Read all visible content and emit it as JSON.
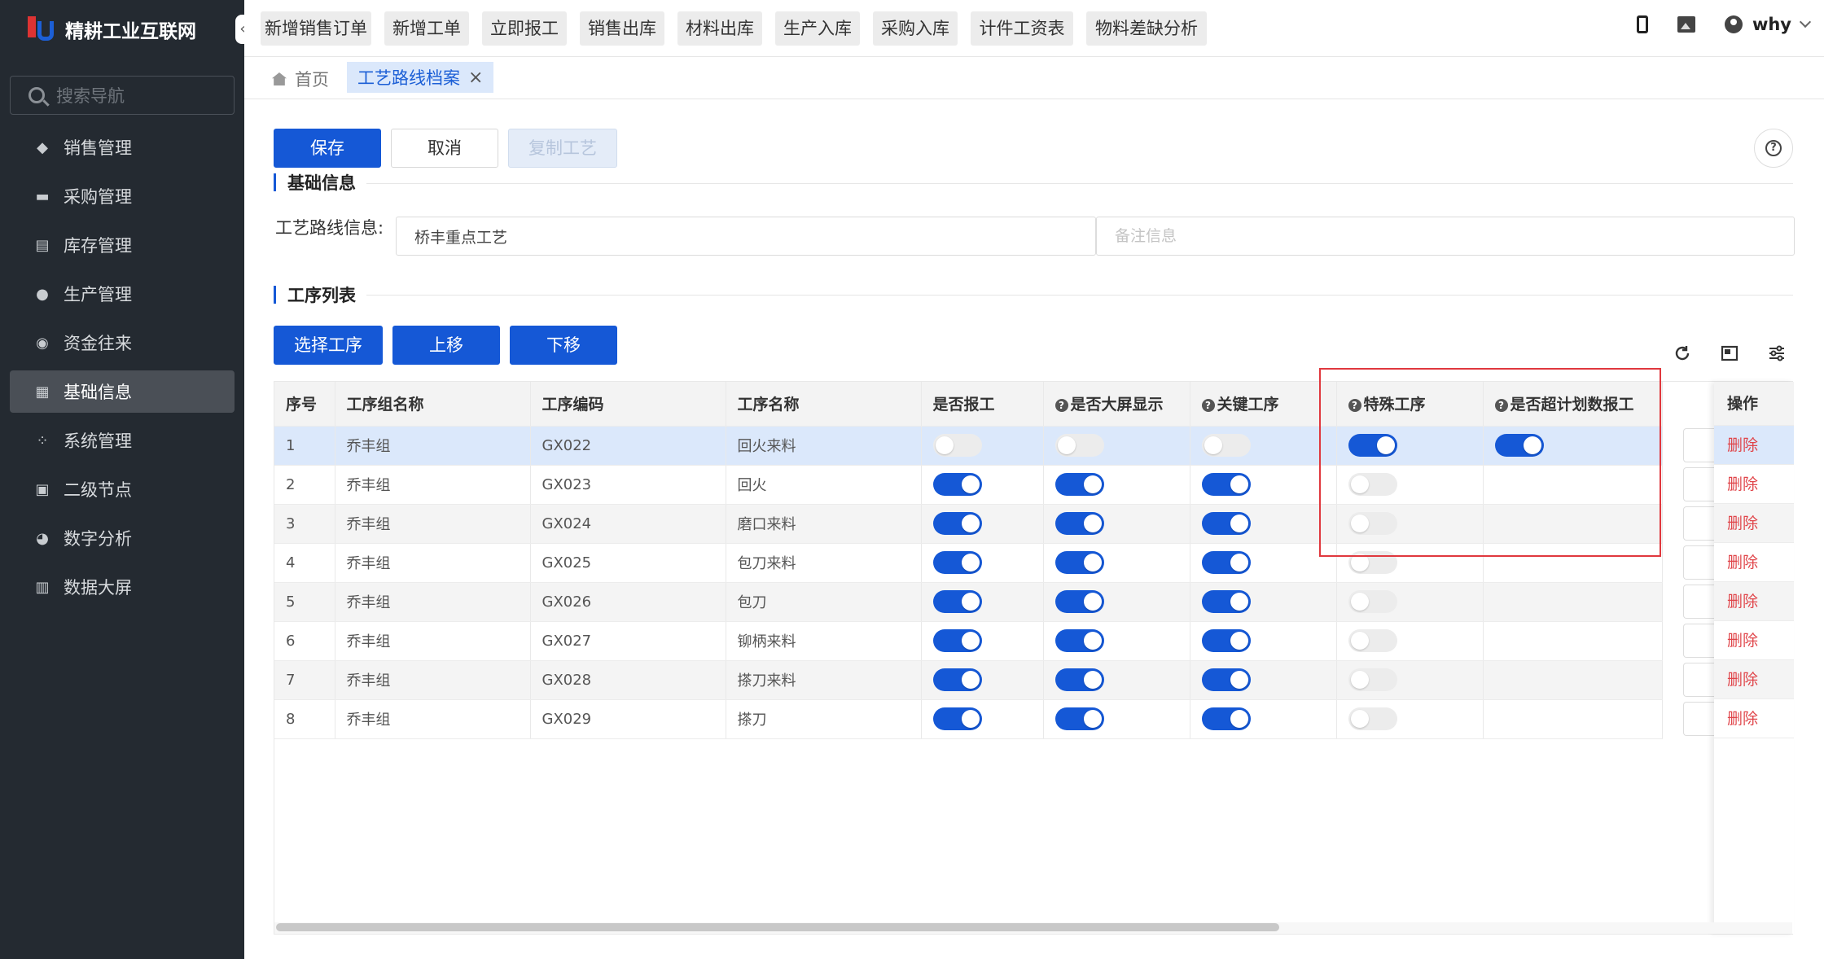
{
  "app": {
    "logo_text": "精耕工业互联网"
  },
  "sidebar": {
    "search_placeholder": "搜索导航",
    "items": [
      {
        "label": "销售管理",
        "icon": "tag-icon"
      },
      {
        "label": "采购管理",
        "icon": "cart-icon"
      },
      {
        "label": "库存管理",
        "icon": "warehouse-icon"
      },
      {
        "label": "生产管理",
        "icon": "production-icon"
      },
      {
        "label": "资金往来",
        "icon": "money-icon"
      },
      {
        "label": "基础信息",
        "icon": "dashboard-icon",
        "active": true
      },
      {
        "label": "系统管理",
        "icon": "grid-icon"
      },
      {
        "label": "二级节点",
        "icon": "doc-icon"
      },
      {
        "label": "数字分析",
        "icon": "pie-icon"
      },
      {
        "label": "数据大屏",
        "icon": "screen-icon"
      }
    ]
  },
  "header": {
    "quick_links": [
      "新增销售订单",
      "新增工单",
      "立即报工",
      "销售出库",
      "材料出库",
      "生产入库",
      "采购入库",
      "计件工资表",
      "物料差缺分析"
    ],
    "user_name": "why"
  },
  "tabs": {
    "home": "首页",
    "active": "工艺路线档案"
  },
  "toolbar": {
    "save": "保存",
    "cancel": "取消",
    "copy": "复制工艺"
  },
  "basic": {
    "title": "基础信息",
    "route_label": "工艺路线信息:",
    "route_value": "桥丰重点工艺",
    "remark_placeholder": "备注信息"
  },
  "process": {
    "title": "工序列表",
    "select_btn": "选择工序",
    "up_btn": "上移",
    "down_btn": "下移"
  },
  "table": {
    "headers": {
      "seq": "序号",
      "group": "工序组名称",
      "code": "工序编码",
      "name": "工序名称",
      "report": "是否报工",
      "screen": "是否大屏显示",
      "key": "关键工序",
      "special": "特殊工序",
      "overplan": "是否超计划数报工",
      "op": "操作"
    },
    "delete_label": "删除",
    "rows": [
      {
        "seq": "1",
        "group": "乔丰组",
        "code": "GX022",
        "name": "回火来料",
        "report": false,
        "screen": false,
        "key": false,
        "special": true,
        "overplan": true
      },
      {
        "seq": "2",
        "group": "乔丰组",
        "code": "GX023",
        "name": "回火",
        "report": true,
        "screen": true,
        "key": true,
        "special": false,
        "overplan": null
      },
      {
        "seq": "3",
        "group": "乔丰组",
        "code": "GX024",
        "name": "磨口来料",
        "report": true,
        "screen": true,
        "key": true,
        "special": false,
        "overplan": null
      },
      {
        "seq": "4",
        "group": "乔丰组",
        "code": "GX025",
        "name": "包刀来料",
        "report": true,
        "screen": true,
        "key": true,
        "special": false,
        "overplan": null
      },
      {
        "seq": "5",
        "group": "乔丰组",
        "code": "GX026",
        "name": "包刀",
        "report": true,
        "screen": true,
        "key": true,
        "special": false,
        "overplan": null
      },
      {
        "seq": "6",
        "group": "乔丰组",
        "code": "GX027",
        "name": "铆柄来料",
        "report": true,
        "screen": true,
        "key": true,
        "special": false,
        "overplan": null
      },
      {
        "seq": "7",
        "group": "乔丰组",
        "code": "GX028",
        "name": "搽刀来料",
        "report": true,
        "screen": true,
        "key": true,
        "special": false,
        "overplan": null
      },
      {
        "seq": "8",
        "group": "乔丰组",
        "code": "GX029",
        "name": "搽刀",
        "report": true,
        "screen": true,
        "key": true,
        "special": false,
        "overplan": null
      }
    ]
  },
  "colors": {
    "primary": "#1558d6",
    "danger": "#e0454a",
    "sidebar_bg": "#242a31",
    "highlight": "#e0383e"
  }
}
